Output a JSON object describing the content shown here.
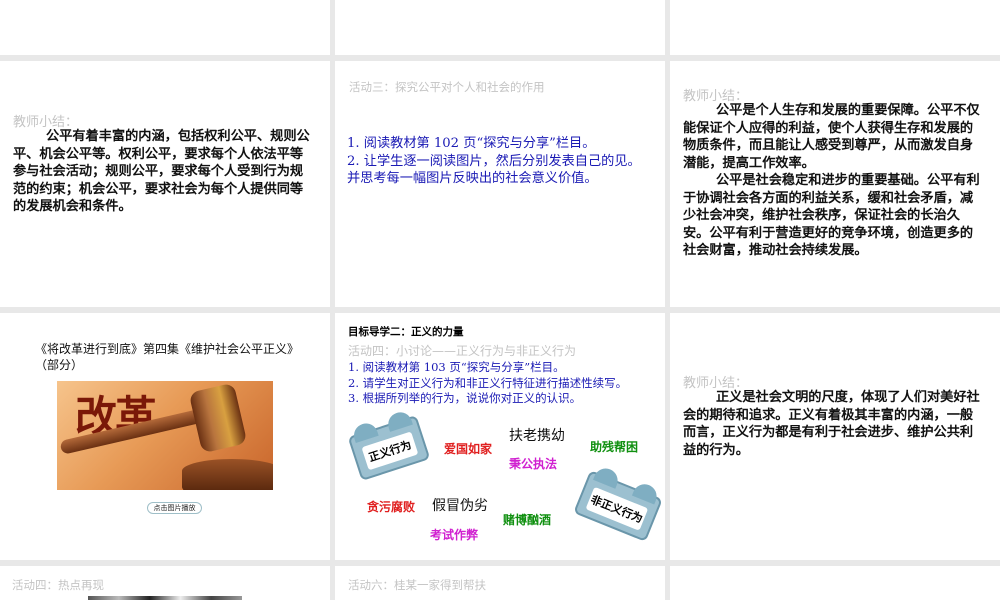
{
  "slides": {
    "r2c1": {
      "title": "教师小结：",
      "text": "公平有着丰富的内涵，包括权利公平、规则公平、机会公平等。权利公平，要求每个人依法平等参与社会活动；规则公平，要求每个人受到行为规范的约束；机会公平，要求社会为每个人提供同等的发展机会和条件。"
    },
    "r2c2": {
      "title": "活动三：探究公平对个人和社会的作用",
      "items": [
        "1. 阅读教材第 102 页“探究与分享”栏目。",
        "2. 让学生逐一阅读图片，然后分别发表自己的见。并思考每一幅图片反映出的社会意义价值。"
      ]
    },
    "r2c3": {
      "title": "教师小结：",
      "p1": "公平是个人生存和发展的重要保障。公平不仅能保证个人应得的利益，使个人获得生存和发展的物质条件，而且能让人感受到尊严，从而激发自身潜能，提高工作效率。",
      "p2": "公平是社会稳定和进步的重要基础。公平有利于协调社会各方面的利益关系，缓和社会矛盾，减少社会冲突，维护社会秩序，保证社会的长治久安。公平有利于营造更好的竞争环境，创造更多的社会财富，推动社会持续发展。"
    },
    "r3c1": {
      "title": "《将改革进行到底》第四集《维护社会公平正义》（部分）",
      "image_text": "改革",
      "callout": "点击图片播放"
    },
    "r3c2": {
      "heading": "目标导学二：正义的力量",
      "title": "活动四：小讨论——正义行为与非正义行为",
      "items": [
        "1. 阅读教材第 103 页“探究与分享”栏目。",
        "2. 请学生对正义行为和非正义行特征进行描述性续写。",
        "3. 根据所列举的行为，说说你对正义的认识。"
      ],
      "sticker_just": "正义行为",
      "sticker_unjust": "非正义行为",
      "words": [
        "爱国如家",
        "扶老携幼",
        "助残帮困",
        "秉公执法",
        "贪污腐败",
        "假冒伪劣",
        "赌博酗酒",
        "考试作弊"
      ]
    },
    "r3c3": {
      "title": "教师小结：",
      "text": "正义是社会文明的尺度，体现了人们对美好社会的期待和追求。正义有着极其丰富的内涵，一般而言，正义行为都是有利于社会进步、维护公共利益的行为。"
    },
    "r4c1": {
      "title": "活动四：热点再现"
    },
    "r4c2": {
      "title": "活动六：桂某一家得到帮扶"
    }
  },
  "colors": {
    "red": "#e02020",
    "green": "#109010",
    "magenta": "#d020d0",
    "blue": "#1a1ab4"
  }
}
